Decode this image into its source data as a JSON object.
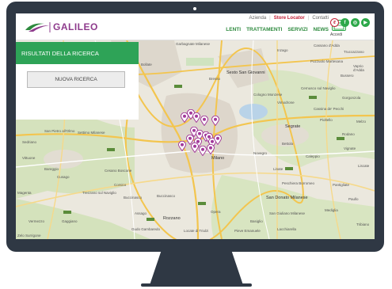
{
  "brand": {
    "name": "GALILEO",
    "color": "#8e3b8c"
  },
  "top_links": [
    "Azienda",
    "Store Locator",
    "Contatti"
  ],
  "nav": [
    "LENTI",
    "TRATTAMENTI",
    "SERVIZI",
    "NEWS"
  ],
  "accedi": "Accedi",
  "panel": {
    "title": "RISULTATI DELLA RICERCA",
    "button": "NUOVA RICERCA"
  },
  "colors": {
    "accent": "#2ea357",
    "pin": "#a23a9a",
    "frame": "#2f3844"
  },
  "map_labels": [
    "Garbagnate Milanese",
    "Bollate",
    "Sesto San Giovanni",
    "Cologno Monzese",
    "Vimodrone",
    "Cernusco sul Naviglio",
    "Rho",
    "Pero",
    "Bresso",
    "Segrate",
    "Pioltello",
    "San Pietro all'Olmo",
    "Sedriano",
    "Vittuone",
    "Arluno",
    "Settimo Milanese",
    "Cusago",
    "Trezzano sul Naviglio",
    "Corsico",
    "Buccinasco",
    "Assago",
    "Rozzano",
    "Opera",
    "Locate di Triulzi",
    "Pieve Emanuele",
    "San Giuliano Milanese",
    "San Donato Milanese",
    "Peschiera Borromeo",
    "Mediglia",
    "Paullo",
    "Gaggiano",
    "Vermezzo",
    "Zelo Surrigone",
    "Gudo Gambaredo",
    "Lacchiarella",
    "Basiglio",
    "Pantigliate",
    "Tribiano",
    "Milano",
    "Linate",
    "Novegro",
    "Caleppio",
    "Bettola",
    "Vignate",
    "Rodano",
    "Liscate",
    "Buccinasco",
    "Cesano Boscone",
    "Cornaredo",
    "Bareggio",
    "Magenta",
    "Bussero",
    "Cassina de' Pecchi",
    "Gorgonzola",
    "Pozzuolo Martesana",
    "Truccazzano",
    "Melzo",
    "Inzago",
    "Cassano d'Adda",
    "Vaprio d'Adda"
  ]
}
